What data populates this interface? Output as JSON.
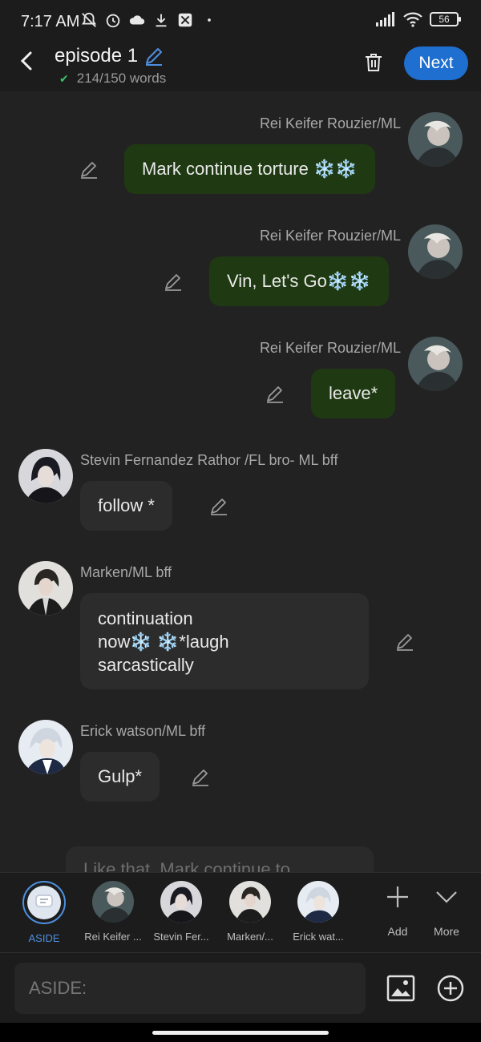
{
  "status_bar": {
    "time": "7:17 AM",
    "battery": "56"
  },
  "header": {
    "title": "episode 1",
    "word_count": "214/150 words",
    "next_label": "Next"
  },
  "messages": [
    {
      "side": "right",
      "name": "Rei Keifer Rouzier/ML",
      "text": "Mark continue torture ❄️❄️"
    },
    {
      "side": "right",
      "name": "Rei Keifer Rouzier/ML",
      "text": "Vin, Let's Go❄️❄️"
    },
    {
      "side": "right",
      "name": "Rei Keifer Rouzier/ML",
      "text": "leave*"
    },
    {
      "side": "left",
      "name": "Stevin Fernandez Rathor /FL bro- ML bff",
      "text": "follow *"
    },
    {
      "side": "left",
      "name": "Marken/ML bff",
      "text_lines": [
        "continuation",
        "now❄️ ❄️*laugh",
        "sarcastically"
      ]
    },
    {
      "side": "left",
      "name": "Erick watson/ML bff",
      "text": "Gulp*"
    }
  ],
  "partial_message": "Like that, Mark continue to",
  "characters": [
    {
      "label": "ASIDE"
    },
    {
      "label": "Rei Keifer ..."
    },
    {
      "label": "Stevin Fer..."
    },
    {
      "label": "Marken/..."
    },
    {
      "label": "Erick wat..."
    }
  ],
  "tools": {
    "add_label": "Add",
    "more_label": "More"
  },
  "input": {
    "placeholder": "ASIDE:"
  },
  "colors": {
    "accent": "#1f6fd1",
    "my_bubble": "#1f3a12",
    "other_bubble": "#2c2c2c"
  }
}
